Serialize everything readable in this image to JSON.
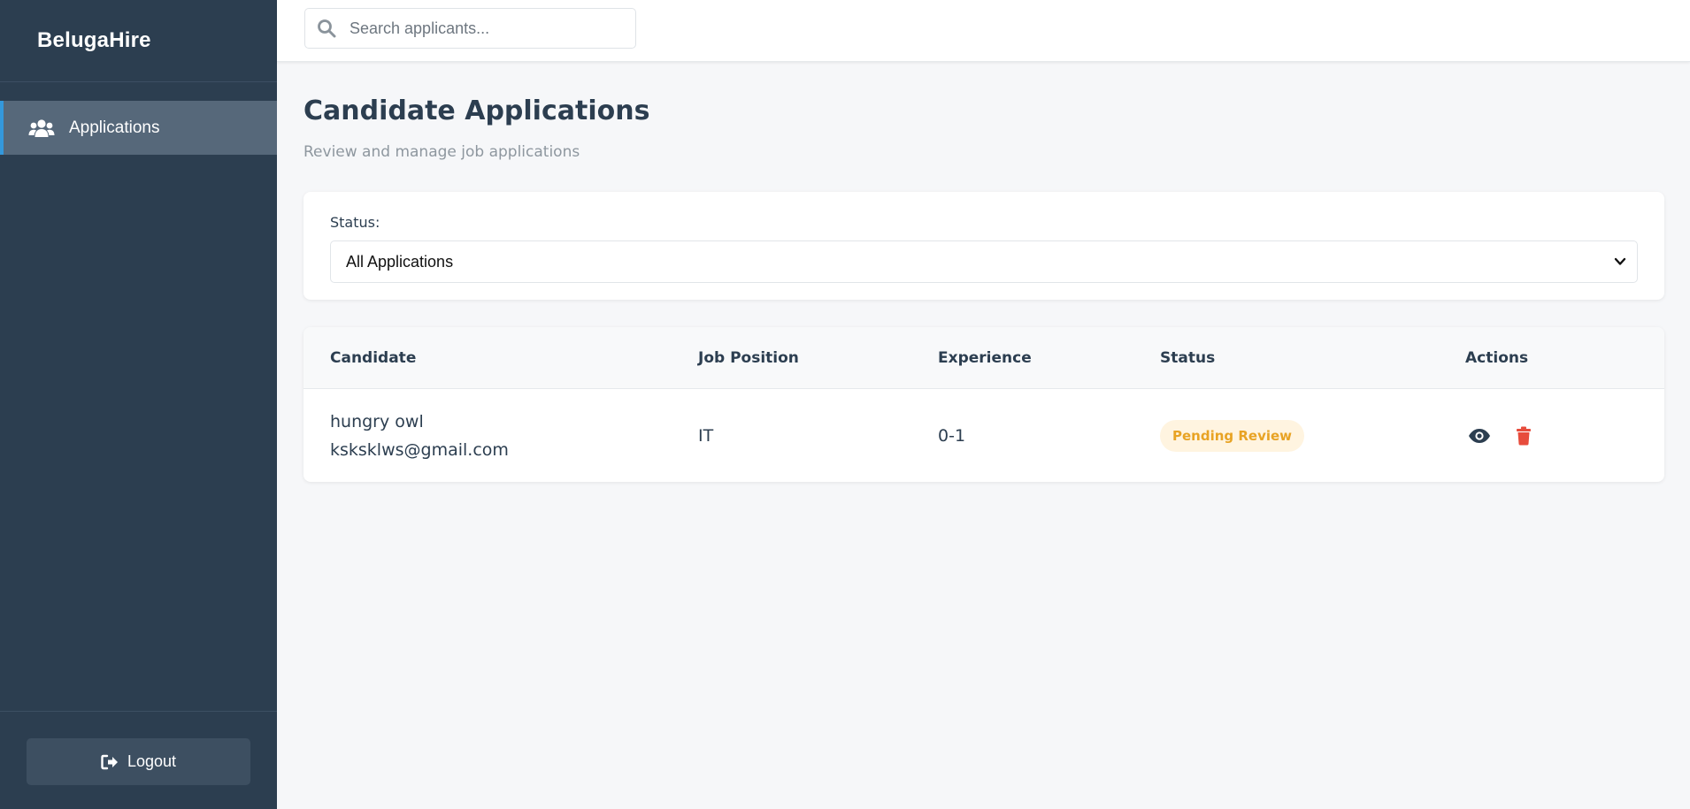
{
  "sidebar": {
    "brand": "BelugaHire",
    "items": [
      {
        "label": "Applications",
        "icon": "users-icon",
        "active": true
      }
    ],
    "logout_label": "Logout",
    "logout_icon": "sign-out-icon"
  },
  "topbar": {
    "search_placeholder": "Search applicants...",
    "search_value": ""
  },
  "main": {
    "title": "Candidate Applications",
    "subtitle": "Review and manage job applications",
    "filter": {
      "label": "Status:",
      "selected": "All Applications"
    },
    "table": {
      "headers": [
        "Candidate",
        "Job Position",
        "Experience",
        "Status",
        "Actions"
      ],
      "rows": [
        {
          "name": "hungry owl",
          "email": "ksksklws@gmail.com",
          "position": "IT",
          "experience": "0-1",
          "status": "Pending Review"
        }
      ]
    }
  },
  "colors": {
    "sidebar_bg": "#2c3e50",
    "active_item_bg": "#56687a",
    "active_accent": "#3498db",
    "badge_text": "#e8a324",
    "badge_bg": "#fff4e0",
    "delete_icon": "#e74c3c",
    "view_icon": "#2c3e50"
  }
}
